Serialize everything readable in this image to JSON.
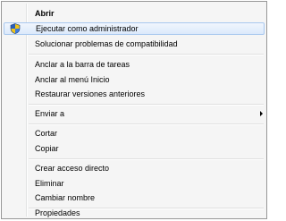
{
  "context_menu": {
    "items": [
      {
        "label": "Abrir"
      },
      {
        "label": "Ejecutar como administrador"
      },
      {
        "label": "Solucionar problemas de compatibilidad"
      },
      {
        "label": "Anclar a la barra de tareas"
      },
      {
        "label": "Anclar al menú Inicio"
      },
      {
        "label": "Restaurar versiones anteriores"
      },
      {
        "label": "Enviar a"
      },
      {
        "label": "Cortar"
      },
      {
        "label": "Copiar"
      },
      {
        "label": "Crear acceso directo"
      },
      {
        "label": "Eliminar"
      },
      {
        "label": "Cambiar nombre"
      },
      {
        "label": "Propiedades"
      }
    ],
    "icons": {
      "run_as_admin": "uac-shield-icon",
      "send_to": "submenu-arrow-icon"
    },
    "colors": {
      "background": "#f5f5f5",
      "border": "#979797",
      "highlight_border": "#a8c8ef",
      "highlight_fill": "#dbe9fb"
    }
  }
}
